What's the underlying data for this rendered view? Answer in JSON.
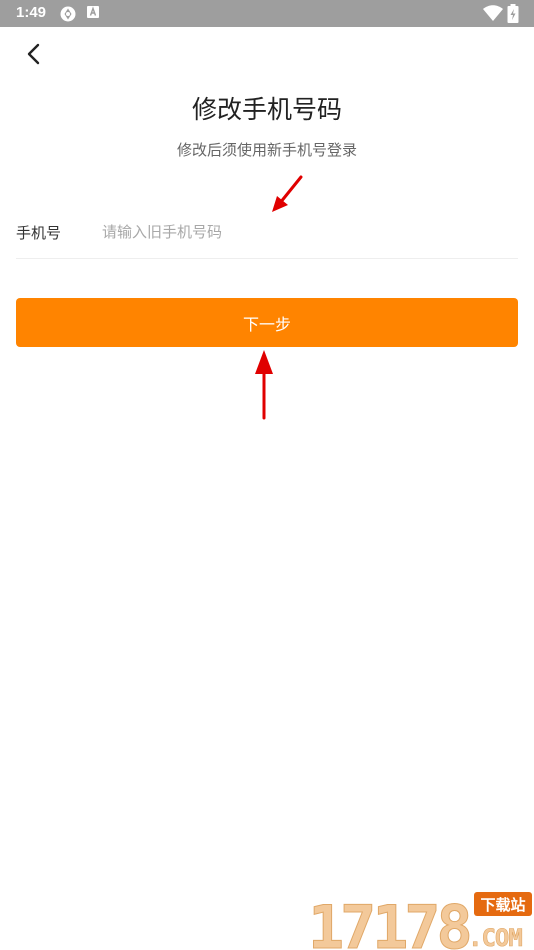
{
  "status_bar": {
    "time": "1:49"
  },
  "header": {
    "back_icon": "chevron-left-icon",
    "title": "修改手机号码",
    "subtitle": "修改后须使用新手机号登录"
  },
  "form": {
    "phone_label": "手机号",
    "phone_value": "",
    "phone_placeholder": "请输入旧手机号码"
  },
  "actions": {
    "next_label": "下一步"
  },
  "watermark": {
    "number": "17178",
    "badge": "下载站",
    "suffix": ".COM"
  },
  "colors": {
    "accent": "#ff8400",
    "status_bar": "#9e9e9e",
    "annotation_arrow": "#e00000"
  }
}
